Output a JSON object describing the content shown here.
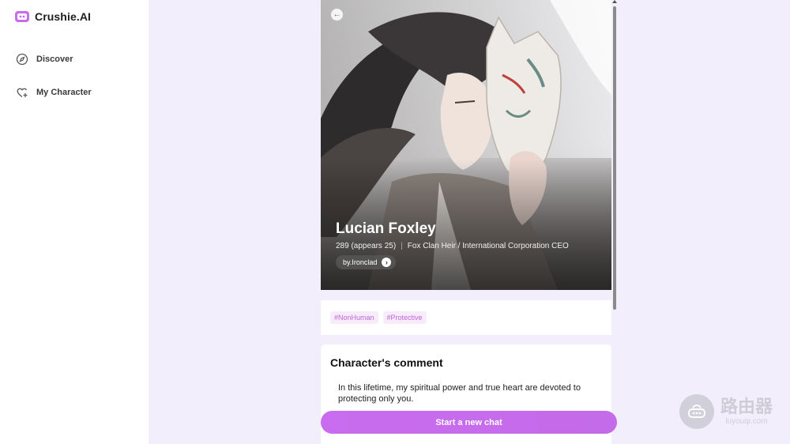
{
  "app": {
    "name": "Crushie.AI",
    "brand_color": "#c86cee"
  },
  "sidebar": {
    "items": [
      {
        "label": "Discover",
        "icon": "compass-icon"
      },
      {
        "label": "My Character",
        "icon": "heart-plus-icon"
      }
    ]
  },
  "character": {
    "name": "Lucian Foxley",
    "age": "289 (appears 25)",
    "separator": "|",
    "role": "Fox Clan Heir / International Corporation CEO",
    "author": "by.Ironclad",
    "tags": [
      "#NonHuman",
      "#Protective"
    ]
  },
  "comment": {
    "title": "Character's comment",
    "text": "In this lifetime, my spiritual power and true heart are devoted to protecting only you."
  },
  "actions": {
    "start_chat": "Start a new chat"
  },
  "watermark": {
    "main": "路由器",
    "sub": "luyouqi.com"
  }
}
